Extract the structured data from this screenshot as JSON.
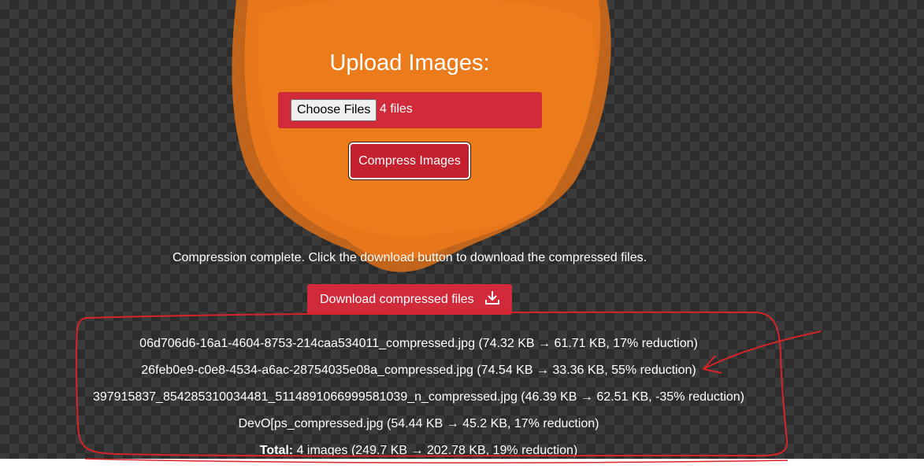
{
  "upload": {
    "title": "Upload Images:",
    "choose_files_label": "Choose Files",
    "files_selected": "4 files"
  },
  "compress_button_label": "Compress Images",
  "status_message": "Compression complete. Click the download button to download the compressed files.",
  "download_button_label": "Download compressed files",
  "results": [
    "06d706d6-16a1-4604-8753-214caa534011_compressed.jpg (74.32 KB → 61.71 KB, 17% reduction)",
    "26feb0e9-c0e8-4534-a6ac-28754035e08a_compressed.jpg (74.54 KB → 33.36 KB, 55% reduction)",
    "397915837_854285310034481_5114891066999581039_n_compressed.jpg (46.39 KB → 62.51 KB, -35% reduction)",
    "DevO[ps_compressed.jpg (54.44 KB → 45.2 KB, 17% reduction)"
  ],
  "total": {
    "label": "Total:",
    "text": " 4 images (249.7 KB → 202.78 KB, 19% reduction)"
  },
  "colors": {
    "accent_red": "#d12a3a",
    "blob_orange": "#e8761a",
    "annotation_red": "#d8232a"
  },
  "icons": {
    "download": "download-icon"
  }
}
